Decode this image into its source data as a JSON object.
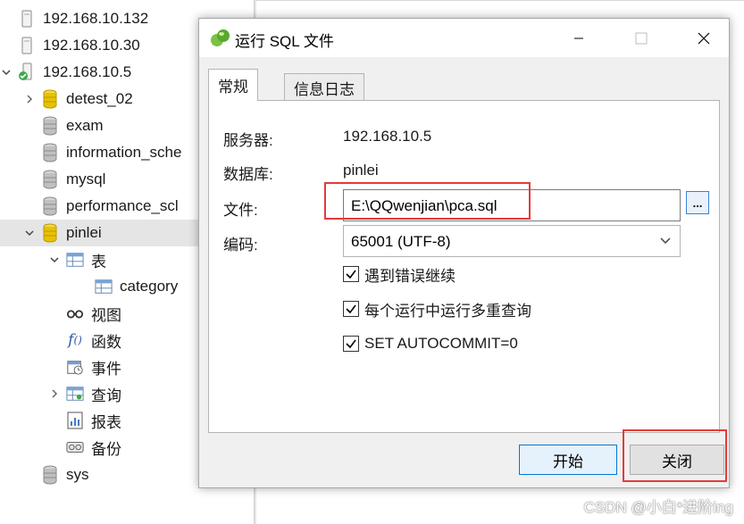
{
  "tree": {
    "items": [
      {
        "label": "192.168.10.132",
        "icon": "server-icon"
      },
      {
        "label": "192.168.10.30",
        "icon": "server-icon"
      },
      {
        "label": "192.168.10.5",
        "icon": "server-connected-icon"
      },
      {
        "label": "detest_02",
        "icon": "database-open-icon"
      },
      {
        "label": "exam",
        "icon": "database-icon"
      },
      {
        "label": "information_sche",
        "icon": "database-icon"
      },
      {
        "label": "mysql",
        "icon": "database-icon"
      },
      {
        "label": "performance_scl",
        "icon": "database-icon"
      },
      {
        "label": "pinlei",
        "icon": "database-open-icon"
      },
      {
        "label": "表",
        "icon": "table-folder-icon"
      },
      {
        "label": "category",
        "icon": "table-icon"
      },
      {
        "label": "视图",
        "icon": "view-icon"
      },
      {
        "label": "函数",
        "icon": "function-icon"
      },
      {
        "label": "事件",
        "icon": "event-icon"
      },
      {
        "label": "查询",
        "icon": "query-icon"
      },
      {
        "label": "报表",
        "icon": "report-icon"
      },
      {
        "label": "备份",
        "icon": "backup-icon"
      },
      {
        "label": "sys",
        "icon": "database-icon"
      }
    ]
  },
  "dialog": {
    "title": "运行 SQL 文件",
    "tabs": [
      {
        "label": "常规"
      },
      {
        "label": "信息日志"
      }
    ],
    "server_label": "服务器:",
    "server_value": "192.168.10.5",
    "database_label": "数据库:",
    "database_value": "pinlei",
    "file_label": "文件:",
    "file_value": "E:\\QQwenjian\\pca.sql",
    "browse_label": "...",
    "encoding_label": "编码:",
    "encoding_value": "65001 (UTF-8)",
    "options": [
      {
        "label": "遇到错误继续",
        "checked": true
      },
      {
        "label": "每个运行中运行多重查询",
        "checked": true
      },
      {
        "label": "SET AUTOCOMMIT=0",
        "checked": true
      }
    ],
    "start_label": "开始",
    "close_label": "关闭"
  },
  "watermark": "CSDN @小白*进阶ing",
  "colors": {
    "accent": "#0078d7",
    "highlight": "#e33b3b",
    "db_yellow": "#e8c100"
  }
}
